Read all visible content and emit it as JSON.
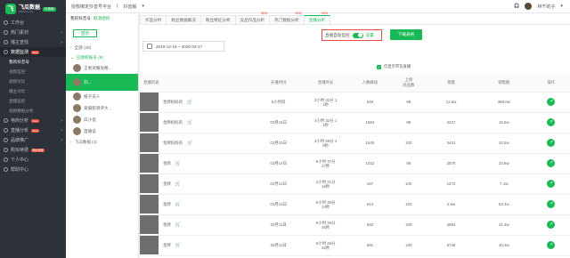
{
  "brand": {
    "logo_mark": "飞",
    "name": "飞瓜数据",
    "sub": "FEIGUA.CN",
    "tag": "抖音版"
  },
  "sidebar": {
    "items": [
      {
        "label": "工作台"
      },
      {
        "label": "热门素材",
        "arrow": "›"
      },
      {
        "label": "播主查找",
        "arrow": "›"
      },
      {
        "label": "数据监测",
        "badge": "New",
        "expanded": true
      },
      {
        "label": "我的抖音号",
        "sub": true,
        "active": true
      },
      {
        "label": "视频监控",
        "sub": true
      },
      {
        "label": "视频对比",
        "sub": true
      },
      {
        "label": "播主对比",
        "sub": true
      },
      {
        "label": "直播监控",
        "sub": true
      },
      {
        "label": "视频数据分析",
        "sub": true
      },
      {
        "label": "电商分析",
        "badge": "New",
        "arrow": "›"
      },
      {
        "label": "直播分析",
        "badge": "New",
        "arrow": "›"
      },
      {
        "label": "品牌推广",
        "arrow": "›"
      },
      {
        "label": "购买续费",
        "badge": "限时特惠"
      },
      {
        "label": "个人中心"
      },
      {
        "label": "帮助中心"
      }
    ]
  },
  "topbar": {
    "breadcrumb": "授权绑定抖音号平台",
    "divider": "|",
    "platform": "抖音版",
    "user": "林千的子"
  },
  "accounts": {
    "title": "我的抖音号",
    "manage": "取消授权",
    "home": "首页",
    "group_all": "全部 (28)",
    "group_auth": "已授权账号 (8)",
    "rows": [
      {
        "name": "王者荣耀攻略..."
      },
      {
        "name": "刘...",
        "selected": true
      },
      {
        "name": "橙子夫人"
      },
      {
        "name": "爱摄影测评大..."
      },
      {
        "name": "白沙瓷"
      },
      {
        "name": "首播说"
      }
    ],
    "group_more": "飞瓜数据 (4)"
  },
  "tabs": [
    {
      "label": "作品分析"
    },
    {
      "label": "粉丝数据概况"
    },
    {
      "label": "粉丝特征分析"
    },
    {
      "label": "竞品作品分析",
      "new": "NEW"
    },
    {
      "label": "热门数据分析",
      "new": "NEW"
    },
    {
      "label": "直播分析",
      "active": true,
      "new": "NEW"
    }
  ],
  "filters": {
    "date_range": "2019-12-18 ~ 2020-03-17",
    "live_switch_label": "直播自动监控",
    "setting_link": "设置",
    "download_button": "下载表格",
    "only_goods_label": "仅显示带货直播"
  },
  "table": {
    "headers": [
      "直播内容",
      "开播时间",
      "直播时长",
      "人数峰值",
      "上榜\n商品数",
      "销量",
      "销售额",
      "操作"
    ],
    "rows": [
      {
        "title": "金牌妈妈的",
        "cart": true,
        "time": "6小时前",
        "dur": [
          "2小时 32分 1",
          "1秒"
        ],
        "peak": "649",
        "goods": "98",
        "sales": "12.5w",
        "amount": "388.0w"
      },
      {
        "title": "金牌妈妈的",
        "cart": true,
        "time": "03月15日",
        "dur": [
          "4小时 32分 1",
          "1秒"
        ],
        "peak": "1684",
        "goods": "99",
        "sales": "2227",
        "amount": "18.6w"
      },
      {
        "title": "金牌妈妈的",
        "cart": true,
        "time": "03月15日",
        "dur": [
          "4小时 56分 4",
          "8秒"
        ],
        "peak": "1645",
        "goods": "100",
        "sales": "3441",
        "amount": "22.5w"
      },
      {
        "title": "金牌",
        "cart": true,
        "time": "03月14日",
        "dur": [
          "5小时 37分",
          "27秒"
        ],
        "peak": "1022",
        "goods": "99",
        "sales": "2876",
        "amount": "22.6w"
      },
      {
        "title": "金牌",
        "cart": true,
        "time": "03月13日",
        "dur": [
          "2小时 21分",
          "16秒"
        ],
        "peak": "167",
        "goods": "100",
        "sales": "1272",
        "amount": "7.1w"
      },
      {
        "title": "金牌",
        "cart": true,
        "time": "03月12日",
        "dur": [
          "5小时 48分",
          "14秒"
        ],
        "peak": "613",
        "goods": "102",
        "sales": "2.5w",
        "amount": "63.4w"
      },
      {
        "title": "金牌",
        "cart": true,
        "time": "03月11日",
        "dur": [
          "5小时 29分",
          "45秒"
        ],
        "peak": "682",
        "goods": "100",
        "sales": "4994",
        "amount": "41.3w"
      },
      {
        "title": "金牌",
        "cart": true,
        "time": "03月11日",
        "dur": [
          "5小时 46分",
          "32秒"
        ],
        "peak": "581",
        "goods": "100",
        "sales": "5748",
        "amount": "40.4w"
      }
    ]
  },
  "colors": {
    "accent": "#19b955",
    "sidebar_bg": "#2d3139",
    "alert": "#e74c3c"
  }
}
